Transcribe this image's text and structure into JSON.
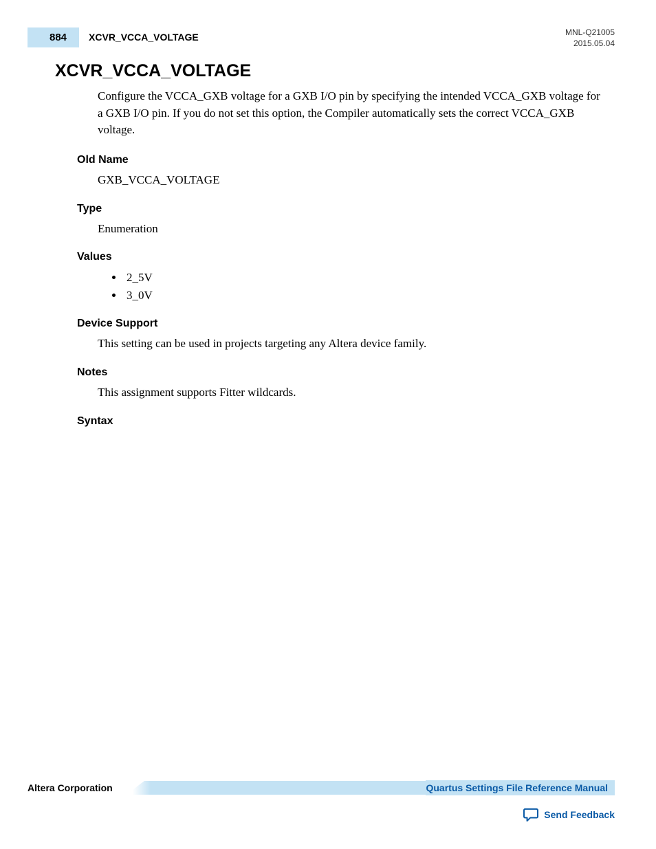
{
  "header": {
    "page_number": "884",
    "running_title": "XCVR_VCCA_VOLTAGE",
    "doc_id": "MNL-Q21005",
    "date": "2015.05.04"
  },
  "title": "XCVR_VCCA_VOLTAGE",
  "description": "Configure the VCCA_GXB voltage for a GXB I/O pin by specifying the intended VCCA_GXB voltage for a GXB I/O pin. If you do not set this option, the Compiler automatically sets the correct VCCA_GXB voltage.",
  "sections": {
    "old_name": {
      "heading": "Old Name",
      "value": "GXB_VCCA_VOLTAGE"
    },
    "type": {
      "heading": "Type",
      "value": "Enumeration"
    },
    "values": {
      "heading": "Values",
      "items": [
        "2_5V",
        "3_0V"
      ]
    },
    "device_support": {
      "heading": "Device Support",
      "value": "This setting can be used in projects targeting any Altera device family."
    },
    "notes": {
      "heading": "Notes",
      "value": "This assignment supports Fitter wildcards."
    },
    "syntax": {
      "heading": "Syntax"
    }
  },
  "footer": {
    "company": "Altera Corporation",
    "manual_link": "Quartus Settings File Reference Manual",
    "feedback": "Send Feedback"
  }
}
